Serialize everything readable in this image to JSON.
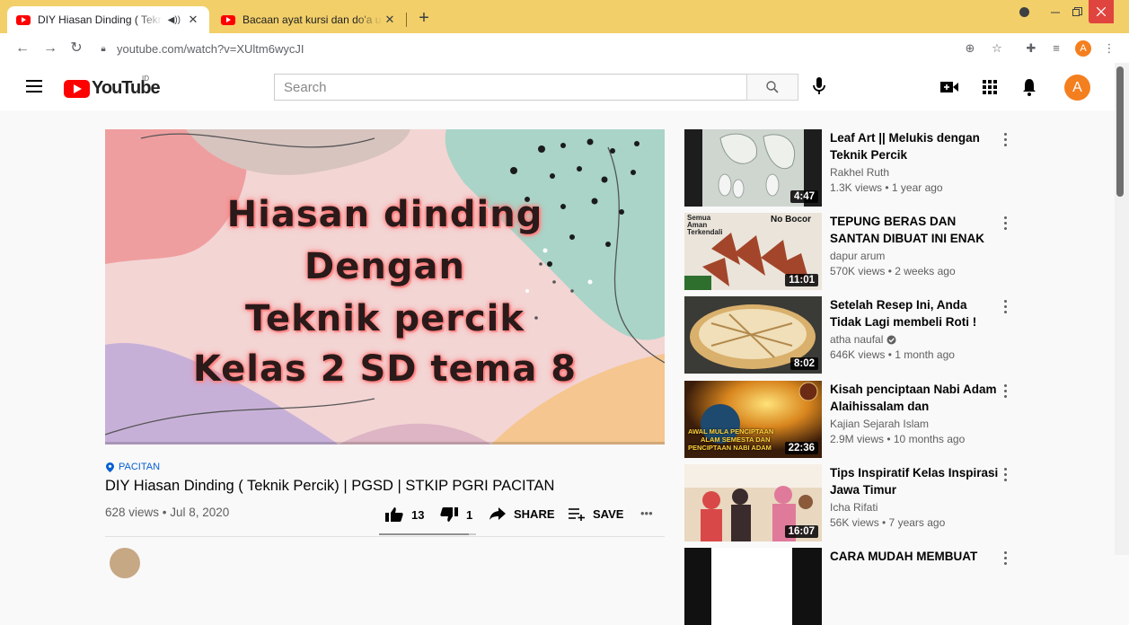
{
  "browser": {
    "tabs": [
      {
        "title": "DIY Hiasan Dinding ( Teknik Percik) | PGSD | STKIP PGRI PACITAN - YouTube",
        "audio_icon": "speaker-icon",
        "close": "✕"
      },
      {
        "title": "Bacaan ayat kursi dan do'a untuk",
        "close": "✕"
      }
    ],
    "new_tab": "+",
    "url": "youtube.com/watch?v=XUltm6wycJI",
    "profile_initial": "A"
  },
  "youtube": {
    "logo_text": "YouTube",
    "country_code": "ID",
    "search_placeholder": "Search",
    "avatar_initial": "A"
  },
  "video": {
    "thumbnail_lines": [
      "Hiasan dinding",
      "Dengan",
      "Teknik percik",
      "Kelas 2 SD tema 8"
    ],
    "hashtag": "PACITAN",
    "title": "DIY Hiasan Dinding ( Teknik Percik) | PGSD | STKIP PGRI PACITAN",
    "views_date": "628 views • Jul 8, 2020",
    "likes": "13",
    "dislikes": "1",
    "like_ratio": 0.93,
    "share_label": "SHARE",
    "save_label": "SAVE",
    "more_label": "•••"
  },
  "recommendations": [
    {
      "title": "Leaf Art || Melukis dengan Teknik Percik Menggunakan...",
      "channel": "Rakhel Ruth",
      "meta": "1.3K views • 1 year ago",
      "duration": "4:47",
      "verified": false,
      "thumb_texts": []
    },
    {
      "title": "TEPUNG BERAS DAN SANTAN DIBUAT INI ENAK BANGET II...",
      "channel": "dapur arum",
      "meta": "570K views • 2 weeks ago",
      "duration": "11:01",
      "verified": false,
      "thumb_texts": [
        "Semua Aman Terkendali",
        "No Bocor"
      ]
    },
    {
      "title": "Setelah Resep Ini, Anda Tidak Lagi membeli Roti ! Anda Aka...",
      "channel": "atha naufal",
      "meta": "646K views • 1 month ago",
      "duration": "8:02",
      "verified": true,
      "thumb_texts": []
    },
    {
      "title": "Kisah penciptaan Nabi Adam Alaihissalam dan penciptaan...",
      "channel": "Kajian Sejarah Islam",
      "meta": "2.9M views • 10 months ago",
      "duration": "22:36",
      "verified": false,
      "thumb_texts": [
        "AWAL MULA PENCIPTAAN",
        "ALAM SEMESTA DAN",
        "PENCIPTAAN NABI ADAM"
      ]
    },
    {
      "title": "Tips Inspiratif Kelas Inspirasi Jawa Timur",
      "channel": "Icha Rifati",
      "meta": "56K views • 7 years ago",
      "duration": "16:07",
      "verified": false,
      "thumb_texts": []
    },
    {
      "title": "CARA MUDAH MEMBUAT",
      "channel": "",
      "meta": "",
      "duration": "",
      "verified": false,
      "thumb_texts": []
    }
  ]
}
